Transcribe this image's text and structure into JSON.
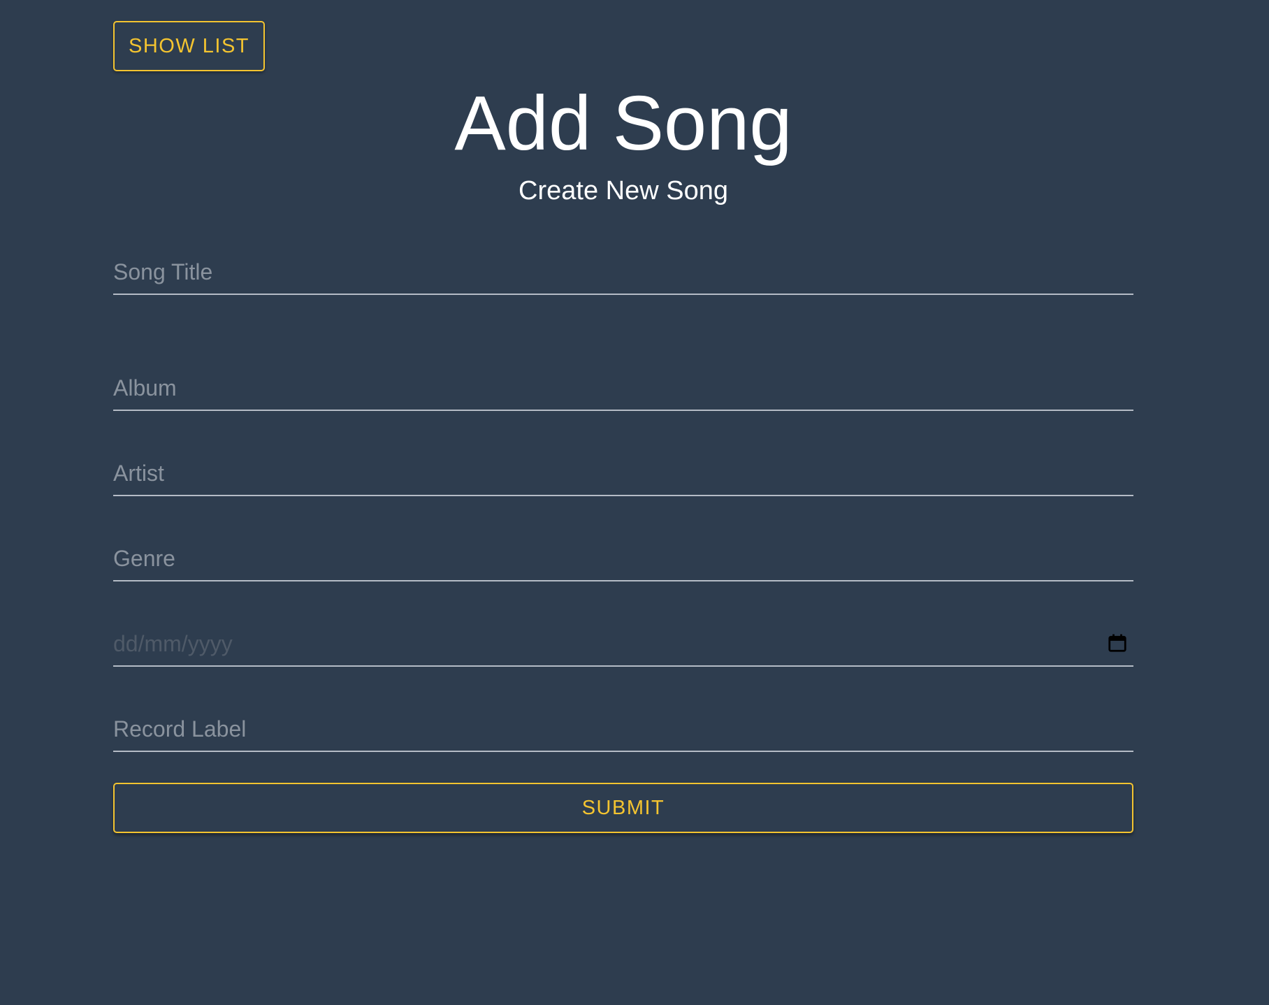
{
  "header": {
    "show_list_label": "SHOW LIST",
    "title": "Add Song",
    "subtitle": "Create New Song"
  },
  "form": {
    "song_title": {
      "placeholder": "Song Title",
      "value": ""
    },
    "album": {
      "placeholder": "Album",
      "value": ""
    },
    "artist": {
      "placeholder": "Artist",
      "value": ""
    },
    "genre": {
      "placeholder": "Genre",
      "value": ""
    },
    "release_date": {
      "placeholder": "dd/mm/yyyy",
      "value": ""
    },
    "record_label": {
      "placeholder": "Record Label",
      "value": ""
    },
    "submit_label": "SUBMIT"
  },
  "icons": {
    "date_picker": "calendar-icon"
  },
  "colors": {
    "background": "#2e3d4f",
    "accent": "#f4c430",
    "text": "#ffffff",
    "placeholder": "#8a939e",
    "underline": "#b5bcc6"
  }
}
